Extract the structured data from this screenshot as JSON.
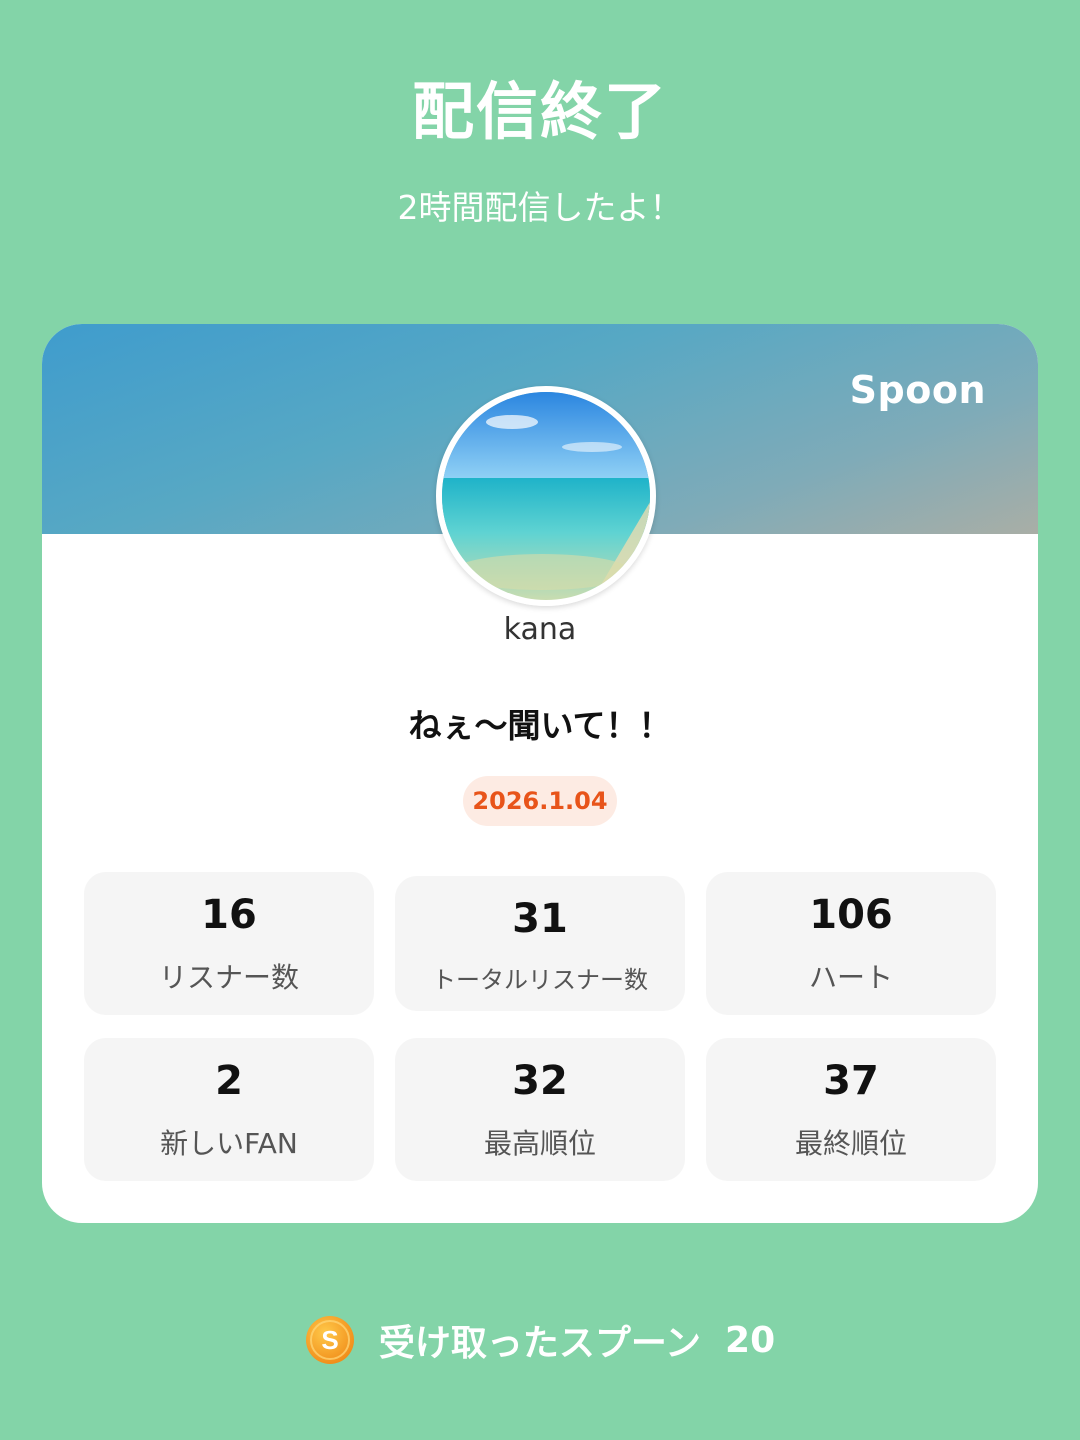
{
  "header": {
    "title": "配信終了",
    "subtitle": "2時間配信したよ！"
  },
  "card": {
    "brand": "Spoon",
    "username": "kana",
    "stream_title": "ねぇ～聞いて！！",
    "date": "2026.1.04",
    "stats": [
      {
        "value": "16",
        "label": "リスナー数"
      },
      {
        "value": "31",
        "label": "トータルリスナー数"
      },
      {
        "value": "106",
        "label": "ハート"
      },
      {
        "value": "2",
        "label": "新しいFAN"
      },
      {
        "value": "32",
        "label": "最高順位"
      },
      {
        "value": "37",
        "label": "最終順位"
      }
    ]
  },
  "footer": {
    "coin_icon": "spoon-coin-icon",
    "label": "受け取ったスプーン",
    "count": "20"
  },
  "colors": {
    "background": "#83D4A8",
    "badge_text": "#E8541A",
    "badge_bg": "#FDEBE3",
    "coin": "#F29A1F"
  }
}
